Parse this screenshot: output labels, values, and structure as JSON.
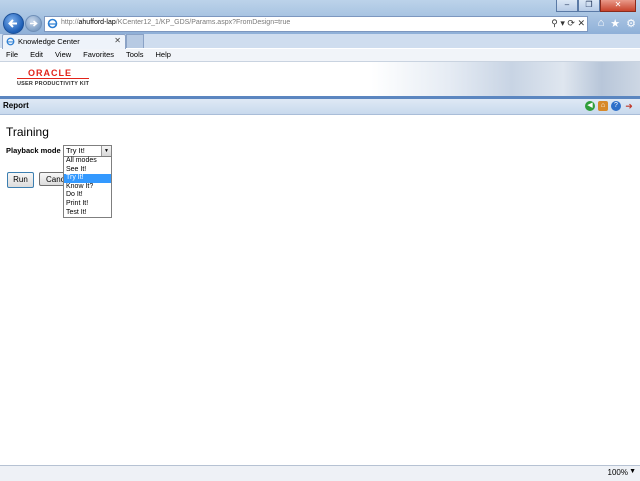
{
  "browser": {
    "url_prefix": "http://",
    "url_host": "ahufford-lap",
    "url_path": "/KCenter12_1/KP_GDS/Params.aspx?FromDesign=true",
    "address_tools": "⚲ ▾ ⟳ ✕",
    "tab_title": "Knowledge Center",
    "tab_close": "✕",
    "menu": [
      "File",
      "Edit",
      "View",
      "Favorites",
      "Tools",
      "Help"
    ],
    "zoom": "100%",
    "window_controls": {
      "minimize": "–",
      "restore": "❐",
      "close": "✕"
    }
  },
  "brand": {
    "logo_text": "ORACLE",
    "subtitle": "USER PRODUCTIVITY KIT",
    "logo_color": "#e2231a"
  },
  "report_bar": {
    "label": "Report",
    "icons": [
      "back-icon",
      "home-icon",
      "help-icon",
      "exit-icon"
    ]
  },
  "content": {
    "title": "Training",
    "playback_label": "Playback mode",
    "selected_mode": "Try It!",
    "modes": [
      "All modes",
      "See It!",
      "Try It!",
      "Know It?",
      "Do It!",
      "Print It!",
      "Test It!"
    ],
    "highlighted_index": 2,
    "run_label": "Run",
    "cancel_label": "Cancel"
  },
  "colors": {
    "selection": "#3399ff",
    "report_bar": "#c8d9ed",
    "header_accent": "#5b86c0"
  }
}
